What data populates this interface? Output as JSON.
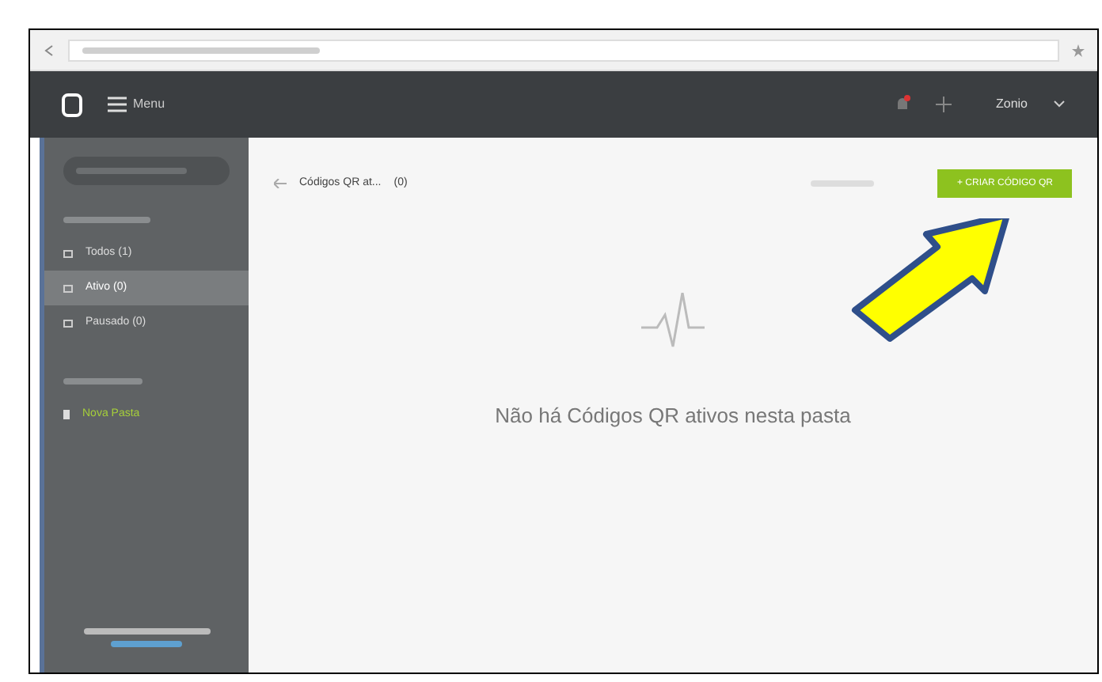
{
  "header": {
    "menu_label": "Menu",
    "user": "Zonio"
  },
  "sidebar": {
    "items": [
      {
        "label": "Todos (1)",
        "selected": false
      },
      {
        "label": "Ativo (0)",
        "selected": true
      },
      {
        "label": "Pausado (0)",
        "selected": false
      }
    ],
    "folders": [
      {
        "label": "Nova Pasta"
      }
    ]
  },
  "main": {
    "breadcrumb": "Códigos QR at...",
    "count": "(0)",
    "create_button": "+ CRIAR CÓDIGO QR",
    "empty_message": "Não há Códigos QR ativos nesta pasta"
  }
}
